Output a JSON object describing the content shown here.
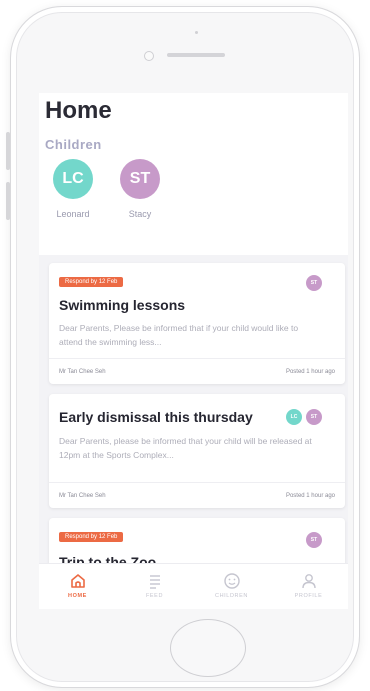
{
  "page": {
    "title": "Home"
  },
  "children": {
    "heading": "Children",
    "items": [
      {
        "initials": "LC",
        "name": "Leonard",
        "color": "#73d7cb"
      },
      {
        "initials": "ST",
        "name": "Stacy",
        "color": "#c79ac9"
      }
    ]
  },
  "feed": {
    "cards": [
      {
        "badge": "Respond by 12 Feb",
        "title": "Swimming lessons",
        "body": "Dear Parents, Please be informed that if your child would like to attend the swimming less...",
        "author": "Mr Tan Chee Seh",
        "posted": "Posted 1 hour ago",
        "tags": [
          "ST"
        ]
      },
      {
        "title": "Early dismissal this thursday",
        "body": "Dear Parents, please be informed that your child will be released at 12pm at the Sports Complex...",
        "author": "Mr Tan Chee Seh",
        "posted": "Posted 1 hour ago",
        "tags": [
          "LC",
          "ST"
        ]
      },
      {
        "badge": "Respond by 12 Feb",
        "title": "Trip to the Zoo",
        "tags": [
          "ST"
        ]
      }
    ]
  },
  "tabbar": {
    "tabs": [
      {
        "label": "HOME",
        "icon": "home-icon",
        "active": true
      },
      {
        "label": "FEED",
        "icon": "feed-icon"
      },
      {
        "label": "CHILDREN",
        "icon": "smiley-icon"
      },
      {
        "label": "PROFILE",
        "icon": "person-icon"
      }
    ]
  },
  "colors": {
    "accent": "#ec6a44",
    "teal": "#73d7cb",
    "purple": "#c79ac9",
    "title": "#2b2b35"
  }
}
